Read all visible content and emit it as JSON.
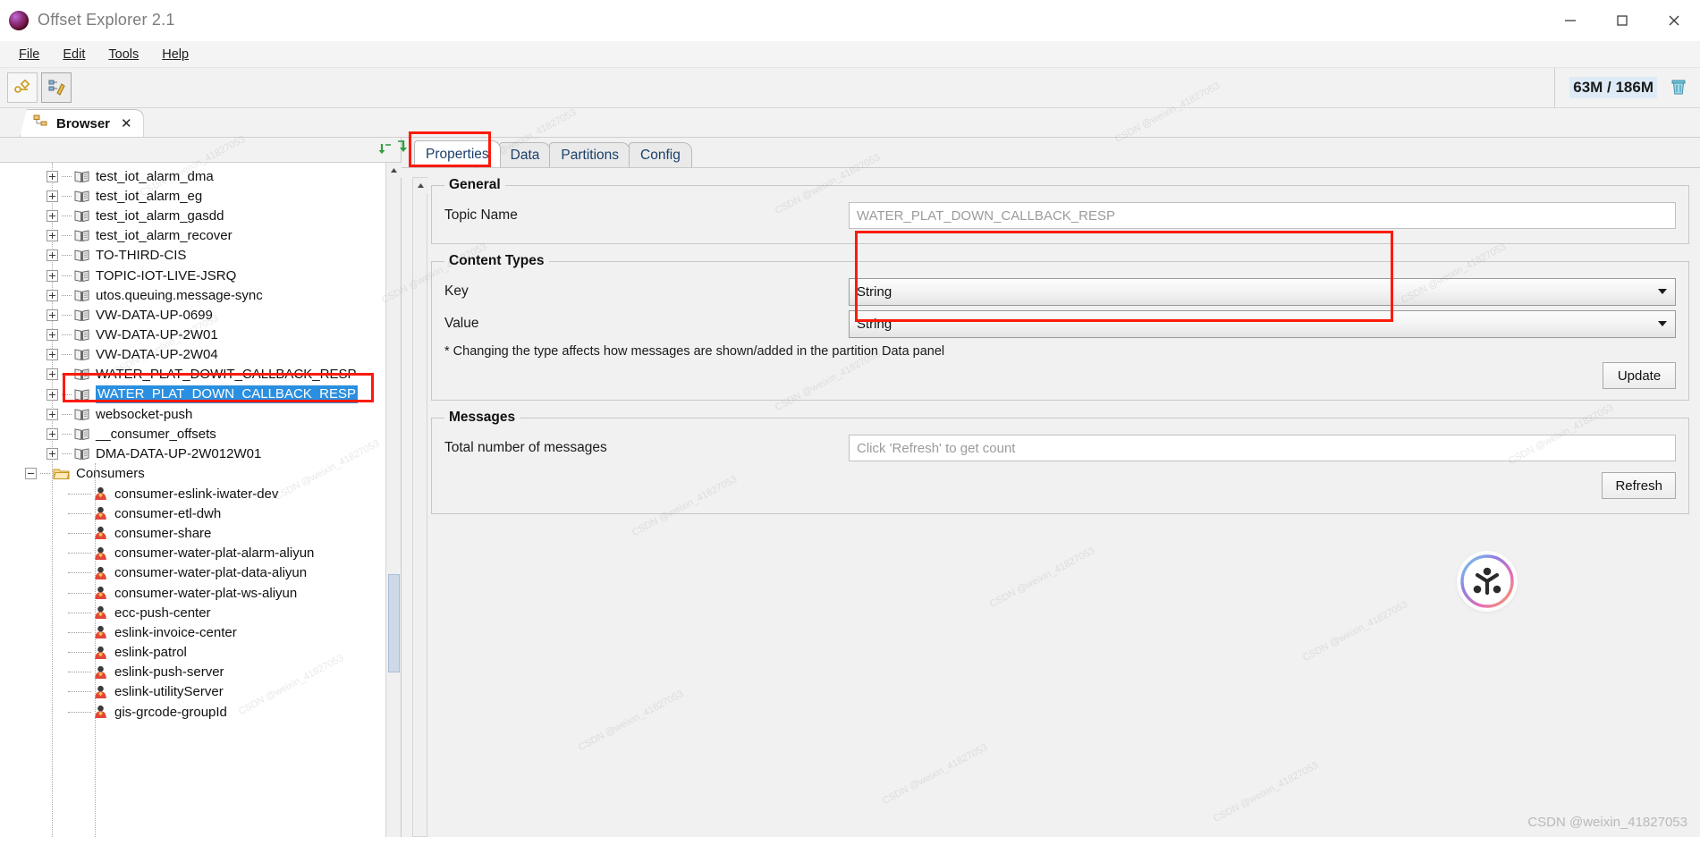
{
  "window": {
    "title": "Offset Explorer  2.1",
    "logo_icon": "offset-explorer-logo",
    "minimize_icon": "minimize-icon",
    "maximize_icon": "maximize-icon",
    "close_icon": "close-icon"
  },
  "menubar": {
    "items": [
      {
        "label": "File",
        "mnemonic": "F"
      },
      {
        "label": "Edit",
        "mnemonic": "E"
      },
      {
        "label": "Tools",
        "mnemonic": "T"
      },
      {
        "label": "Help",
        "mnemonic": "H"
      }
    ]
  },
  "toolbar": {
    "buttons": [
      {
        "name": "add-cluster-button",
        "icon": "connect-icon"
      },
      {
        "name": "edit-cluster-button",
        "icon": "tree-edit-icon"
      }
    ],
    "memory": {
      "text": "63M / 186M",
      "used": "63M",
      "total": "186M",
      "trash_icon": "trash-icon",
      "highlight_color": "#deebf7"
    }
  },
  "tabstrip": {
    "tabs": [
      {
        "label": "Browser",
        "icon": "browser-tree-icon",
        "close": "✕",
        "active": true
      }
    ]
  },
  "tree": {
    "header_icon": "collapse-all-icon",
    "items": [
      {
        "label": "test_iot_alarm_dma",
        "type": "topic",
        "indent": 1,
        "expandable": true,
        "selected": false
      },
      {
        "label": "test_iot_alarm_eg",
        "type": "topic",
        "indent": 1,
        "expandable": true,
        "selected": false
      },
      {
        "label": "test_iot_alarm_gasdd",
        "type": "topic",
        "indent": 1,
        "expandable": true,
        "selected": false
      },
      {
        "label": "test_iot_alarm_recover",
        "type": "topic",
        "indent": 1,
        "expandable": true,
        "selected": false
      },
      {
        "label": "TO-THIRD-CIS",
        "type": "topic",
        "indent": 1,
        "expandable": true,
        "selected": false
      },
      {
        "label": "TOPIC-IOT-LIVE-JSRQ",
        "type": "topic",
        "indent": 1,
        "expandable": true,
        "selected": false
      },
      {
        "label": "utos.queuing.message-sync",
        "type": "topic",
        "indent": 1,
        "expandable": true,
        "selected": false
      },
      {
        "label": "VW-DATA-UP-0699",
        "type": "topic",
        "indent": 1,
        "expandable": true,
        "selected": false
      },
      {
        "label": "VW-DATA-UP-2W01",
        "type": "topic",
        "indent": 1,
        "expandable": true,
        "selected": false
      },
      {
        "label": "VW-DATA-UP-2W04",
        "type": "topic",
        "indent": 1,
        "expandable": true,
        "selected": false
      },
      {
        "label": "WATER_PLAT_DOWIT_CALLBACK_RESP",
        "type": "topic",
        "indent": 1,
        "expandable": true,
        "selected": false
      },
      {
        "label": "WATER_PLAT_DOWN_CALLBACK_RESP",
        "type": "topic",
        "indent": 1,
        "expandable": true,
        "selected": true
      },
      {
        "label": "websocket-push",
        "type": "topic",
        "indent": 1,
        "expandable": true,
        "selected": false
      },
      {
        "label": "__consumer_offsets",
        "type": "topic",
        "indent": 1,
        "expandable": true,
        "selected": false
      },
      {
        "label": "DMA-DATA-UP-2W012W01",
        "type": "topic",
        "indent": 1,
        "expandable": true,
        "selected": false
      },
      {
        "label": "Consumers",
        "type": "folder",
        "indent": 0,
        "expandable": true,
        "expanded": true,
        "selected": false
      },
      {
        "label": "consumer-eslink-iwater-dev",
        "type": "consumer",
        "indent": 2,
        "expandable": false,
        "selected": false
      },
      {
        "label": "consumer-etl-dwh",
        "type": "consumer",
        "indent": 2,
        "expandable": false,
        "selected": false
      },
      {
        "label": "consumer-share",
        "type": "consumer",
        "indent": 2,
        "expandable": false,
        "selected": false
      },
      {
        "label": "consumer-water-plat-alarm-aliyun",
        "type": "consumer",
        "indent": 2,
        "expandable": false,
        "selected": false
      },
      {
        "label": "consumer-water-plat-data-aliyun",
        "type": "consumer",
        "indent": 2,
        "expandable": false,
        "selected": false
      },
      {
        "label": "consumer-water-plat-ws-aliyun",
        "type": "consumer",
        "indent": 2,
        "expandable": false,
        "selected": false
      },
      {
        "label": "ecc-push-center",
        "type": "consumer",
        "indent": 2,
        "expandable": false,
        "selected": false
      },
      {
        "label": "eslink-invoice-center",
        "type": "consumer",
        "indent": 2,
        "expandable": false,
        "selected": false
      },
      {
        "label": "eslink-patrol",
        "type": "consumer",
        "indent": 2,
        "expandable": false,
        "selected": false
      },
      {
        "label": "eslink-push-server",
        "type": "consumer",
        "indent": 2,
        "expandable": false,
        "selected": false
      },
      {
        "label": "eslink-utilityServer",
        "type": "consumer",
        "indent": 2,
        "expandable": false,
        "selected": false
      },
      {
        "label": "gis-grcode-groupId",
        "type": "consumer",
        "indent": 2,
        "expandable": false,
        "selected": false
      }
    ]
  },
  "detail": {
    "tabs": [
      {
        "label": "Properties",
        "active": true
      },
      {
        "label": "Data",
        "active": false
      },
      {
        "label": "Partitions",
        "active": false
      },
      {
        "label": "Config",
        "active": false
      }
    ],
    "general": {
      "legend": "General",
      "topic_name_label": "Topic Name",
      "topic_name_value": "WATER_PLAT_DOWN_CALLBACK_RESP"
    },
    "content_types": {
      "legend": "Content Types",
      "key_label": "Key",
      "key_value": "String",
      "value_label": "Value",
      "value_value": "String",
      "note": "* Changing the type affects how messages are shown/added in the partition Data panel",
      "update_label": "Update"
    },
    "messages": {
      "legend": "Messages",
      "total_label": "Total number of messages",
      "total_placeholder": "Click 'Refresh' to get count",
      "refresh_label": "Refresh"
    }
  },
  "annotations": {
    "color": "#fb1b0c",
    "boxes": [
      {
        "name": "properties-tab-highlight"
      },
      {
        "name": "content-types-highlight"
      },
      {
        "name": "selected-topic-highlight"
      }
    ]
  },
  "watermark": {
    "csdn": "CSDN @weixin_41827053"
  }
}
